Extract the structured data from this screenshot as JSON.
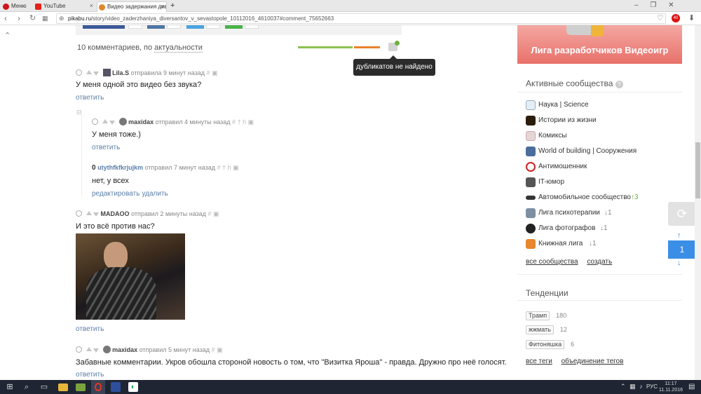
{
  "browser": {
    "tabs": [
      {
        "label": "Меню",
        "icon": "opera-icon"
      },
      {
        "label": "YouTube",
        "icon": "youtube-icon"
      },
      {
        "label": "Видео задержания дивер",
        "icon": "pikabu-icon"
      }
    ],
    "new_tab": "+",
    "url_host": "pikabu.ru",
    "url_path": "/story/video_zaderzhaniya_diversantov_v_sevastopole_10112016_4610037#comment_75652663",
    "badge": "40"
  },
  "comments_header": {
    "count_text": "10 комментариев, по",
    "sort_label": "актуальности",
    "tooltip": "дубликатов не найдено"
  },
  "comments": [
    {
      "user": "Lila.S",
      "action": "отправила 9 минут назад",
      "text": "У меня одной это видео без звука?",
      "reply": "ответить"
    },
    {
      "user": "maxidax",
      "action": "отправил 4 минуты назад",
      "text": "У меня тоже.)",
      "reply": "ответить"
    },
    {
      "rating": "0",
      "user": "utythfkfkrjujkm",
      "action": "отправил 7 минут назад",
      "text": "нет, у всех",
      "edit": "редактировать",
      "delete": "удалить"
    },
    {
      "user": "MADAOO",
      "action": "отправил 2 минуты назад",
      "text": "И это всё против нас?",
      "reply": "ответить"
    },
    {
      "user": "maxidax",
      "action": "отправил 5 минут назад",
      "text": "Забавные комментарии. Укров обошла стороной новость о том, что \"Визитка Яроша\" - правда. Дружно про неё голосят.",
      "reply": "ответить"
    }
  ],
  "banner": {
    "text": "Лига разработчиков Видеоигр"
  },
  "communities": {
    "title": "Активные сообщества",
    "items": [
      {
        "name": "Наука | Science",
        "delta": ""
      },
      {
        "name": "Истории из жизни",
        "delta": ""
      },
      {
        "name": "Комиксы",
        "delta": ""
      },
      {
        "name": "World of building | Сооружения",
        "delta": ""
      },
      {
        "name": "Антимошенник",
        "delta": ""
      },
      {
        "name": "IT-юмор",
        "delta": ""
      },
      {
        "name": "Автомобильное сообщество",
        "delta": "↑3"
      },
      {
        "name": "Лига психотерапии",
        "delta": "↓1"
      },
      {
        "name": "Лига фотографов",
        "delta": "↓1"
      },
      {
        "name": "Книжная лига",
        "delta": "↓1"
      }
    ],
    "all_link": "все сообщества",
    "create_link": "создать"
  },
  "trends": {
    "title": "Тенденции",
    "items": [
      {
        "tag": "Трамп",
        "count": "180"
      },
      {
        "tag": "жжмать",
        "count": "12"
      },
      {
        "tag": "Фитоняшка",
        "count": "6"
      }
    ],
    "all_tags": "все теги",
    "merge_tags": "объединение тегов"
  },
  "scroll_widget": {
    "page": "1",
    "up": "↑",
    "down": "↓"
  },
  "taskbar": {
    "lang": "РУС",
    "time": "11:17",
    "date": "11.11.2016"
  },
  "colors": {
    "link": "#5a7fa8",
    "tooltip_bg": "#2b2b2b",
    "banner_bg": "#d9534f",
    "scroll_blue": "#3a8ee6",
    "taskbar": "#1f2533"
  }
}
